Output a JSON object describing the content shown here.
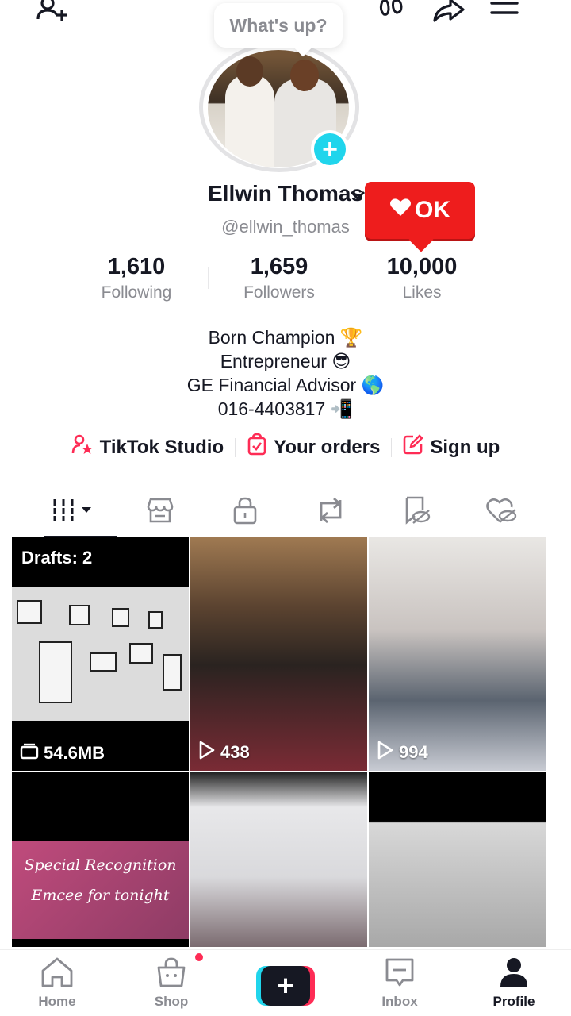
{
  "topbar": {
    "add_friend": "add-friend-icon",
    "footprint": "footprints-icon",
    "share": "share-icon",
    "menu": "menu-icon"
  },
  "status_bubble": "What's up?",
  "profile": {
    "name": "Ellwin Thomas",
    "handle": "@ellwin_thomas",
    "stats": [
      {
        "value": "1,610",
        "label": "Following"
      },
      {
        "value": "1,659",
        "label": "Followers"
      },
      {
        "value": "10,000",
        "label": "Likes"
      }
    ],
    "bio": [
      "Born Champion 🏆",
      "Entrepreneur 😎",
      "GE Financial Advisor 🌎",
      "016-4403817 📲"
    ]
  },
  "like_popup": "OK",
  "links": [
    {
      "label": "TikTok Studio",
      "icon": "studio-icon"
    },
    {
      "label": "Your orders",
      "icon": "orders-icon"
    },
    {
      "label": "Sign up",
      "icon": "edit-icon"
    }
  ],
  "tabs": [
    "videos-grid",
    "shop",
    "private-lock",
    "reposts",
    "favorites",
    "liked"
  ],
  "grid": {
    "drafts_label": "Drafts: 2",
    "drafts_size": "54.6MB",
    "views": [
      "438",
      "994"
    ],
    "script_lines": [
      "Special Recognition",
      "Emcee for tonight"
    ]
  },
  "bottom_nav": [
    {
      "label": "Home"
    },
    {
      "label": "Shop"
    },
    {
      "label": ""
    },
    {
      "label": "Inbox"
    },
    {
      "label": "Profile"
    }
  ],
  "colors": {
    "accent": "#fe2c55",
    "cyan": "#20d5ec",
    "like_popup": "#ee1d1d"
  }
}
